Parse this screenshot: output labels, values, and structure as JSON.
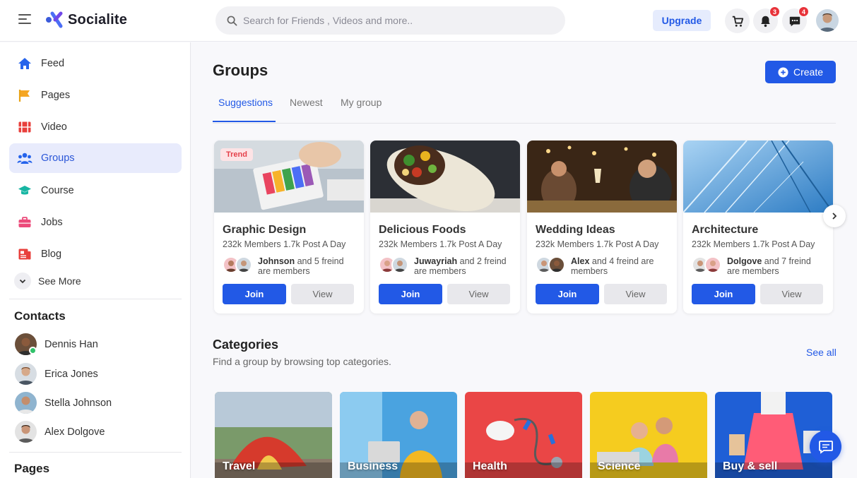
{
  "app": {
    "name": "Socialite"
  },
  "header": {
    "search_placeholder": "Search for Friends , Videos and more..",
    "upgrade_label": "Upgrade",
    "notifications_count": "3",
    "messages_count": "4"
  },
  "sidebar": {
    "items": [
      {
        "label": "Feed",
        "icon": "home-icon"
      },
      {
        "label": "Pages",
        "icon": "flag-icon"
      },
      {
        "label": "Video",
        "icon": "film-icon"
      },
      {
        "label": "Groups",
        "icon": "users-icon"
      },
      {
        "label": "Course",
        "icon": "graduation-cap-icon"
      },
      {
        "label": "Jobs",
        "icon": "briefcase-icon"
      },
      {
        "label": "Blog",
        "icon": "blog-icon"
      }
    ],
    "see_more": "See More",
    "contacts_title": "Contacts",
    "contacts": [
      "Dennis Han",
      "Erica Jones",
      "Stella Johnson",
      "Alex Dolgove"
    ],
    "pages_title": "Pages"
  },
  "main": {
    "title": "Groups",
    "create_label": "Create",
    "tabs": [
      "Suggestions",
      "Newest",
      "My group"
    ],
    "groups": [
      {
        "name": "Graphic Design",
        "stats": "232k Members 1.7k Post A Day",
        "friend": "Johnson",
        "friend_rest": " and 5 freind are members",
        "badge": "Trend",
        "join": "Join",
        "view": "View"
      },
      {
        "name": "Delicious Foods",
        "stats": "232k Members 1.7k Post A Day",
        "friend": "Juwayriah",
        "friend_rest": " and 2 freind are members",
        "join": "Join",
        "view": "View"
      },
      {
        "name": "Wedding Ideas",
        "stats": "232k Members 1.7k Post A Day",
        "friend": "Alex",
        "friend_rest": " and 4 freind are members",
        "join": "Join",
        "view": "View"
      },
      {
        "name": "Architecture",
        "stats": "232k Members 1.7k Post A Day",
        "friend": "Dolgove",
        "friend_rest": " and 7 freind are members",
        "join": "Join",
        "view": "View"
      }
    ],
    "categories_title": "Categories",
    "categories_subtitle": "Find a group by browsing top categories.",
    "see_all": "See all",
    "categories": [
      "Travel",
      "Business",
      "Health",
      "Science",
      "Buy & sell"
    ]
  },
  "colors": {
    "accent": "#2259e6",
    "active_bg": "#e8ebfc",
    "badge": "#e8333a"
  }
}
